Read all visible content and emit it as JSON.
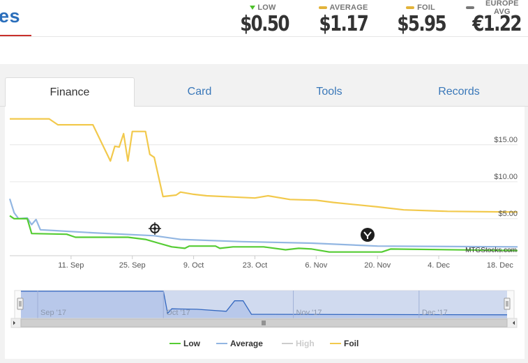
{
  "header": {
    "site_title_fragment": "es",
    "stats": [
      {
        "label": "LOW",
        "value": "$0.50",
        "color": "#4cc02a",
        "marker": "triangle-down-icon"
      },
      {
        "label": "AVERAGE",
        "value": "$1.17",
        "color": "#e2b33a",
        "marker": "bar-icon"
      },
      {
        "label": "FOIL",
        "value": "$5.95",
        "color": "#e2b33a",
        "marker": "bar-icon"
      },
      {
        "label": "EUROPE AVG",
        "value": "€1.22",
        "color": "#777777",
        "marker": "bar-icon"
      }
    ]
  },
  "tabs": [
    {
      "label": "Finance",
      "active": true
    },
    {
      "label": "Card",
      "active": false
    },
    {
      "label": "Tools",
      "active": false
    },
    {
      "label": "Records",
      "active": false
    }
  ],
  "colors": {
    "low": "#55cc33",
    "average": "#92b6e2",
    "high": "#cccccc",
    "foil": "#f2c94c",
    "navigator_fill": "#c8d3ec",
    "navigator_line": "#3468c0",
    "link": "#3a78b9"
  },
  "chart_data": {
    "type": "line",
    "x_start": "2017-08-28",
    "x_end": "2017-12-22",
    "xlim": [
      "2017-08-28",
      "2017-12-22"
    ],
    "ylim": [
      0,
      19.5
    ],
    "y_ticks": [
      {
        "value": 5,
        "label": "$5.00"
      },
      {
        "value": 10,
        "label": "$10.00"
      },
      {
        "value": 15,
        "label": "$15.00"
      }
    ],
    "x_ticks": [
      {
        "date": "2017-09-11",
        "label": "11. Sep"
      },
      {
        "date": "2017-09-25",
        "label": "25. Sep"
      },
      {
        "date": "2017-10-09",
        "label": "9. Oct"
      },
      {
        "date": "2017-10-23",
        "label": "23. Oct"
      },
      {
        "date": "2017-11-06",
        "label": "6. Nov"
      },
      {
        "date": "2017-11-20",
        "label": "20. Nov"
      },
      {
        "date": "2017-12-04",
        "label": "4. Dec"
      },
      {
        "date": "2017-12-18",
        "label": "18. Dec"
      }
    ],
    "grid": true,
    "legend_placement": "bottom",
    "series": [
      {
        "name": "Low",
        "color": "#55cc33",
        "points": [
          [
            "2017-08-28",
            5.4
          ],
          [
            "2017-08-29",
            5.0
          ],
          [
            "2017-09-01",
            5.0
          ],
          [
            "2017-09-02",
            3.0
          ],
          [
            "2017-09-10",
            2.9
          ],
          [
            "2017-09-12",
            2.5
          ],
          [
            "2017-09-24",
            2.5
          ],
          [
            "2017-09-28",
            2.2
          ],
          [
            "2017-10-01",
            1.7
          ],
          [
            "2017-10-04",
            1.2
          ],
          [
            "2017-10-07",
            1.0
          ],
          [
            "2017-10-08",
            1.3
          ],
          [
            "2017-10-14",
            1.3
          ],
          [
            "2017-10-15",
            1.0
          ],
          [
            "2017-10-18",
            1.2
          ],
          [
            "2017-10-25",
            1.2
          ],
          [
            "2017-10-30",
            0.8
          ],
          [
            "2017-11-02",
            1.0
          ],
          [
            "2017-11-05",
            0.9
          ],
          [
            "2017-11-09",
            0.5
          ],
          [
            "2017-11-21",
            0.5
          ],
          [
            "2017-11-23",
            0.9
          ],
          [
            "2017-12-22",
            0.7
          ]
        ]
      },
      {
        "name": "Average",
        "color": "#92b6e2",
        "points": [
          [
            "2017-08-28",
            7.7
          ],
          [
            "2017-08-29",
            5.8
          ],
          [
            "2017-08-30",
            5.0
          ],
          [
            "2017-09-01",
            5.1
          ],
          [
            "2017-09-02",
            4.2
          ],
          [
            "2017-09-03",
            4.9
          ],
          [
            "2017-09-04",
            3.5
          ],
          [
            "2017-09-07",
            3.4
          ],
          [
            "2017-09-16",
            3.1
          ],
          [
            "2017-09-30",
            2.7
          ],
          [
            "2017-10-06",
            2.2
          ],
          [
            "2017-10-20",
            1.9
          ],
          [
            "2017-11-05",
            1.7
          ],
          [
            "2017-11-20",
            1.3
          ],
          [
            "2017-12-22",
            1.2
          ]
        ]
      },
      {
        "name": "High",
        "color": "#cccccc",
        "points": []
      },
      {
        "name": "Foil",
        "color": "#f2c94c",
        "points": [
          [
            "2017-08-28",
            18.5
          ],
          [
            "2017-09-06",
            18.5
          ],
          [
            "2017-09-08",
            17.7
          ],
          [
            "2017-09-16",
            17.7
          ],
          [
            "2017-09-20",
            12.8
          ],
          [
            "2017-09-21",
            14.8
          ],
          [
            "2017-09-22",
            14.7
          ],
          [
            "2017-09-23",
            16.5
          ],
          [
            "2017-09-24",
            12.8
          ],
          [
            "2017-09-25",
            16.8
          ],
          [
            "2017-09-28",
            16.8
          ],
          [
            "2017-09-29",
            13.7
          ],
          [
            "2017-09-30",
            13.3
          ],
          [
            "2017-10-02",
            8.0
          ],
          [
            "2017-10-05",
            8.2
          ],
          [
            "2017-10-06",
            8.6
          ],
          [
            "2017-10-09",
            8.3
          ],
          [
            "2017-10-12",
            8.1
          ],
          [
            "2017-10-23",
            7.8
          ],
          [
            "2017-10-26",
            8.1
          ],
          [
            "2017-10-31",
            7.6
          ],
          [
            "2017-11-06",
            7.5
          ],
          [
            "2017-11-10",
            7.2
          ],
          [
            "2017-11-20",
            6.6
          ],
          [
            "2017-11-26",
            6.2
          ],
          [
            "2017-12-06",
            6.0
          ],
          [
            "2017-12-22",
            5.9
          ]
        ]
      }
    ],
    "watermark": "MTGStocks.com",
    "navigator": {
      "x_start": "2017-08-28",
      "x_end": "2017-12-22",
      "labels": [
        {
          "date": "2017-09-01",
          "label": "Sep '17"
        },
        {
          "date": "2017-10-01",
          "label": "Oct '17"
        },
        {
          "date": "2017-11-01",
          "label": "Nov '17"
        },
        {
          "date": "2017-12-01",
          "label": "Dec '17"
        }
      ],
      "points": [
        [
          "2017-08-28",
          1.0
        ],
        [
          "2017-10-01",
          1.0
        ],
        [
          "2017-10-02",
          0.12
        ],
        [
          "2017-10-03",
          0.3
        ],
        [
          "2017-10-09",
          0.28
        ],
        [
          "2017-10-16",
          0.2
        ],
        [
          "2017-10-18",
          0.62
        ],
        [
          "2017-10-20",
          0.62
        ],
        [
          "2017-10-22",
          0.08
        ],
        [
          "2017-12-22",
          0.06
        ]
      ]
    }
  }
}
